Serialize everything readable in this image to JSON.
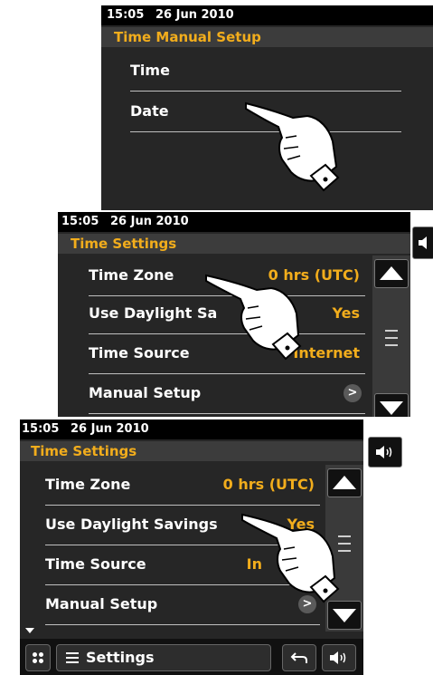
{
  "screen1": {
    "time": "15:05",
    "date": "26 Jun 2010",
    "header": "Time Manual Setup",
    "items": [
      {
        "label": "Time"
      },
      {
        "label": "Date"
      }
    ]
  },
  "screen2": {
    "time": "15:05",
    "date": "26 Jun 2010",
    "header": "Time Settings",
    "items": [
      {
        "label": "Time Zone",
        "value": "0 hrs (UTC)"
      },
      {
        "label": "Use Daylight Sa",
        "value": "Yes"
      },
      {
        "label": "Time Source",
        "value": "Internet"
      },
      {
        "label": "Manual Setup",
        "value": ">"
      }
    ]
  },
  "screen3": {
    "time": "15:05",
    "date": "26 Jun 2010",
    "header": "Time Settings",
    "items": [
      {
        "label": "Time Zone",
        "value": "0 hrs (UTC)"
      },
      {
        "label": "Use Daylight Savings",
        "value": "Yes"
      },
      {
        "label": "Time Source",
        "value": "In"
      },
      {
        "label": "Manual Setup",
        "value": ">"
      }
    ],
    "footer": {
      "menu_label": "Settings"
    }
  },
  "icons": [
    "hand-pointer-icon",
    "scroll-up-icon",
    "scroll-down-icon",
    "scroll-grip-icon",
    "speaker-icon",
    "grid-icon",
    "menu-lines-icon",
    "back-arrow-icon",
    "chevron-right-icon"
  ],
  "colors": {
    "accent": "#f2ad1c",
    "background": "#262626",
    "statusbar": "#000000"
  }
}
